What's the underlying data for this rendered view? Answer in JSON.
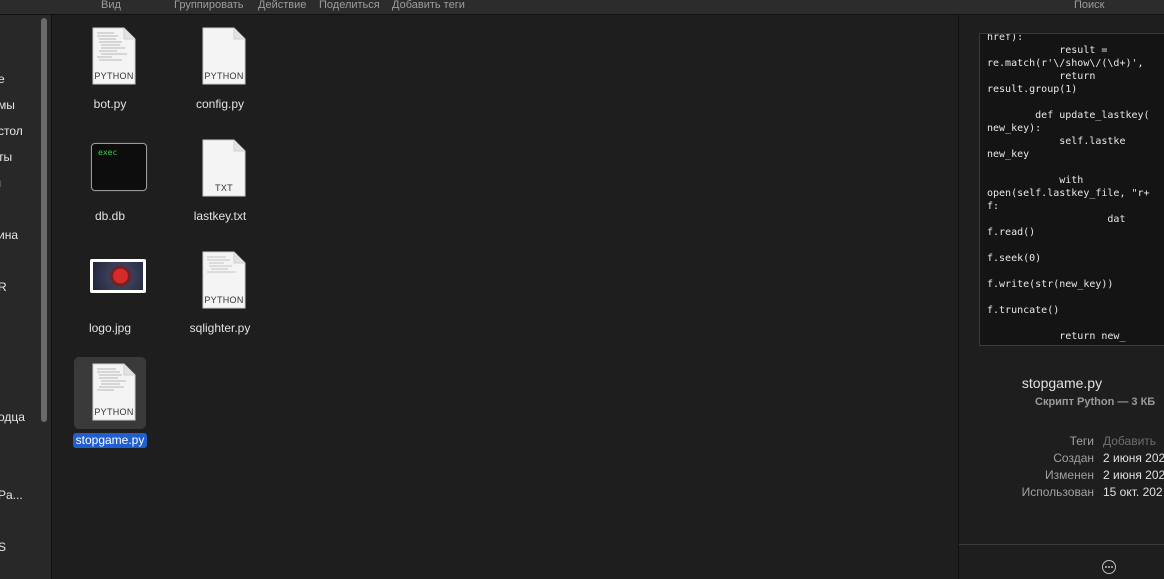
{
  "toolbar": {
    "view": "Вид",
    "group": "Группировать",
    "action": "Действие",
    "share": "Поделиться",
    "add_tags": "Добавить теги",
    "search": "Поиск"
  },
  "sidebar": {
    "items": [
      "е",
      "мы",
      "стол",
      "ты",
      "ı",
      "ина",
      "R",
      "одца",
      "Pa...",
      "S"
    ]
  },
  "files": [
    {
      "name": "bot.py",
      "kind_label": "PYTHON",
      "icon": "python-doc-icon"
    },
    {
      "name": "config.py",
      "kind_label": "PYTHON",
      "icon": "python-doc-icon"
    },
    {
      "name": "db.db",
      "kind_label": "exec",
      "icon": "exec-icon"
    },
    {
      "name": "lastkey.txt",
      "kind_label": "TXT",
      "icon": "text-doc-icon"
    },
    {
      "name": "logo.jpg",
      "kind_label": "",
      "icon": "image-thumbnail-icon"
    },
    {
      "name": "sqlighter.py",
      "kind_label": "PYTHON",
      "icon": "python-doc-icon"
    },
    {
      "name": "stopgame.py",
      "kind_label": "PYTHON",
      "icon": "python-doc-icon",
      "selected": true
    }
  ],
  "preview": {
    "code": "href):\n            result =\nre.match(r'\\/show\\/(\\d+)',\n            return\nresult.group(1)\n\n        def update_lastkey(\nnew_key):\n            self.lastke\nnew_key\n\n            with\nopen(self.lastkey_file, \"r+\nf:\n                    dat\nf.read()\n\nf.seek(0)\n\nf.write(str(new_key))\n\nf.truncate()\n\n            return new_",
    "filename": "stopgame.py",
    "kind": "Скрипт Python — 3 КБ",
    "meta": [
      {
        "key": "Теги",
        "value": "Добавить",
        "muted": true
      },
      {
        "key": "Создан",
        "value": "2 июня 202"
      },
      {
        "key": "Изменен",
        "value": "2 июня 202"
      },
      {
        "key": "Использован",
        "value": "15 окт. 202"
      }
    ]
  }
}
